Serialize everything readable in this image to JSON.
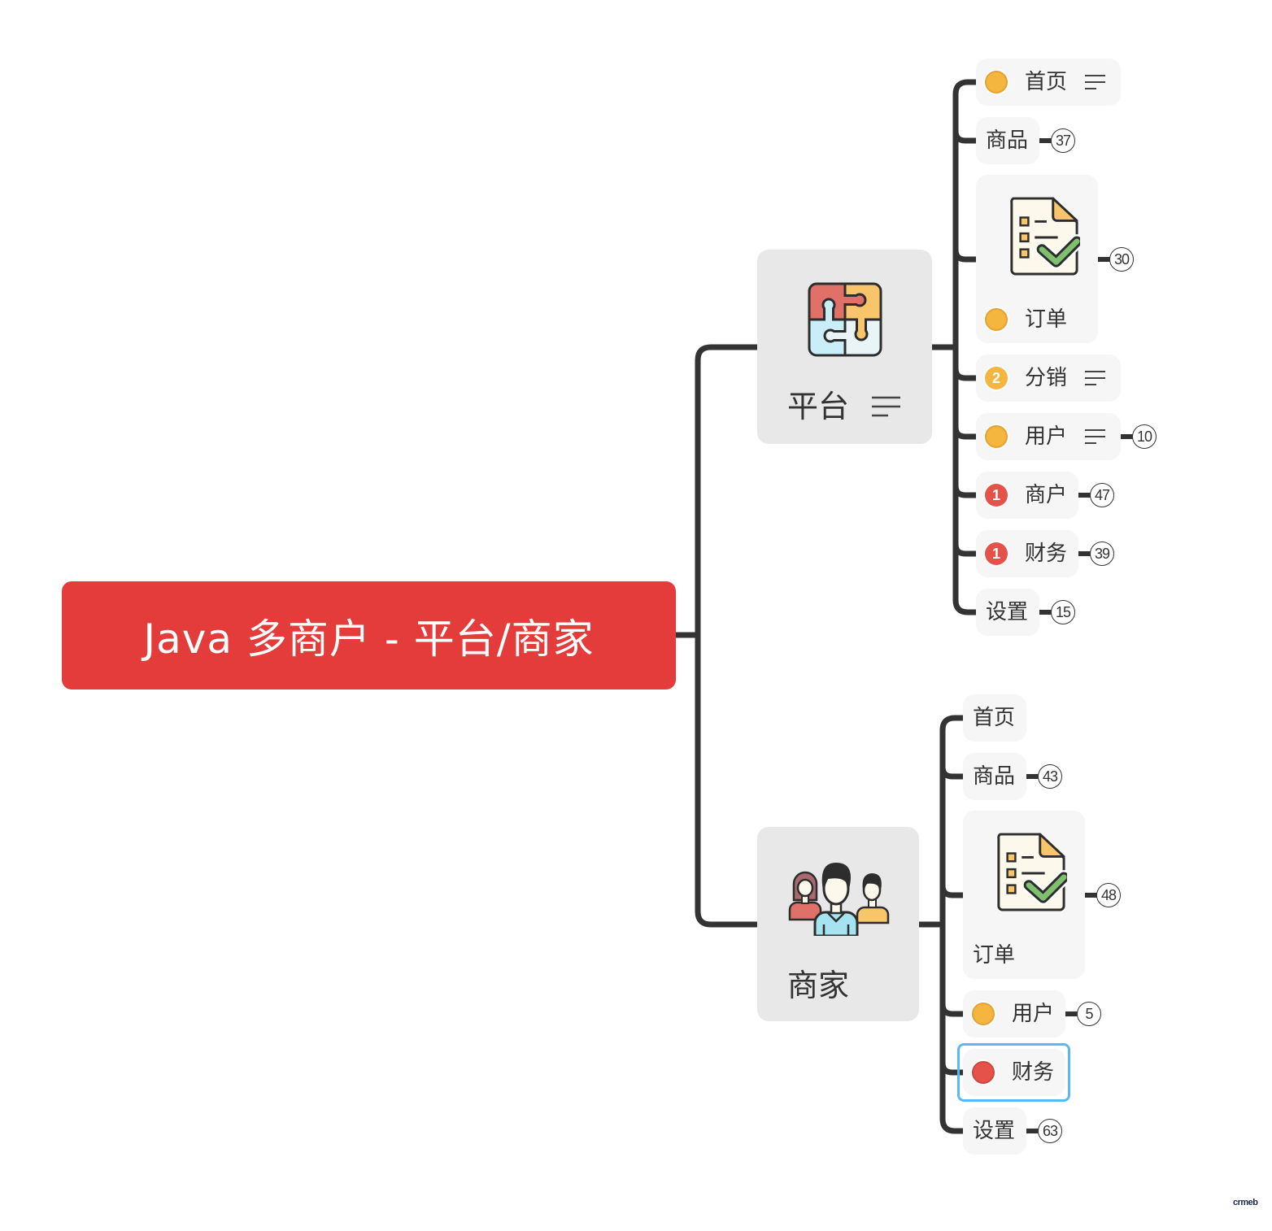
{
  "root": {
    "title": "Java 多商户 - 平台/商家"
  },
  "branches": [
    {
      "label": "平台",
      "icon": "puzzle-icon",
      "has_notes": true,
      "children": [
        {
          "label": "首页",
          "marker": "task-orange",
          "has_notes": true
        },
        {
          "label": "商品",
          "count": 37
        },
        {
          "label": "订单",
          "icon": "checklist-document-icon",
          "marker": "task-orange",
          "count": 30
        },
        {
          "label": "分销",
          "marker": "priority-2",
          "marker_text": "2",
          "has_notes": true
        },
        {
          "label": "用户",
          "marker": "task-orange",
          "has_notes": true,
          "count": 10
        },
        {
          "label": "商户",
          "marker": "priority-1",
          "marker_text": "1",
          "count": 47
        },
        {
          "label": "财务",
          "marker": "priority-1",
          "marker_text": "1",
          "count": 39
        },
        {
          "label": "设置",
          "count": 15
        }
      ]
    },
    {
      "label": "商家",
      "icon": "team-icon",
      "children": [
        {
          "label": "首页"
        },
        {
          "label": "商品",
          "count": 43
        },
        {
          "label": "订单",
          "icon": "checklist-document-icon",
          "count": 48
        },
        {
          "label": "用户",
          "marker": "task-orange",
          "count": 5
        },
        {
          "label": "财务",
          "marker": "task-red",
          "selected": true
        },
        {
          "label": "设置",
          "count": 63
        }
      ]
    }
  ],
  "watermark": "crmeb",
  "colors": {
    "root": "#e33c3a",
    "branch_bg": "#e8e8e8",
    "child_bg": "#f6f6f6",
    "connector": "#333333",
    "marker_orange": "#f4b63f",
    "marker_red": "#e5524a",
    "selection": "#5ab9f2"
  }
}
